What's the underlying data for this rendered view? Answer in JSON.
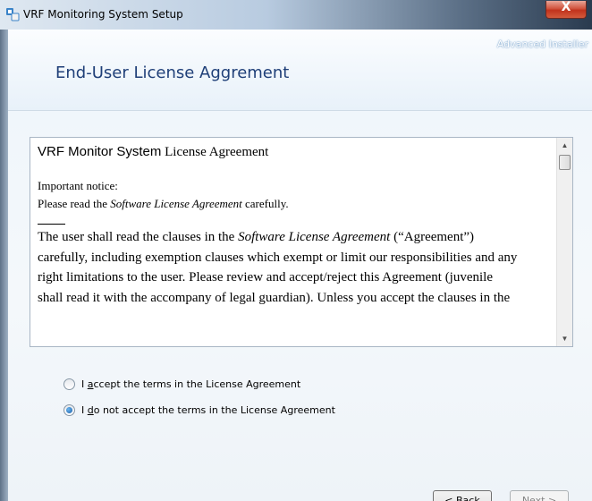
{
  "window": {
    "title": "VRF Monitoring System Setup",
    "close_label": "X",
    "brand": "Advanced Installer"
  },
  "header": {
    "title": "End-User License Aggrement"
  },
  "license": {
    "title_part1": "VRF Monitor System",
    "title_part2": " License Agreement",
    "important": "Important notice:",
    "please_prefix": "Please read the ",
    "please_italic": "Software License Agreement",
    "please_suffix": " carefully.",
    "para_line1_prefix": "The user shall read the clauses in the ",
    "para_line1_italic": "Software License Agreement",
    "para_line1_suffix": " (“Agreement”)",
    "para_line2": "carefully, including exemption clauses which exempt or limit our responsibilities and any",
    "para_line3": "right limitations to the user. Please review and accept/reject this Agreement (juvenile",
    "para_line4": "shall read it with the accompany of legal guardian). Unless you accept the clauses in the"
  },
  "options": {
    "accept_pre": "I ",
    "accept_u": "a",
    "accept_post": "ccept the terms in the License Agreement",
    "decline_pre": "I ",
    "decline_u": "d",
    "decline_post": "o not accept the terms in the License Agreement",
    "selected": "decline"
  },
  "buttons": {
    "back": "< Back",
    "next": "Next >"
  },
  "colors": {
    "title_blue": "#1f3f78",
    "close_red": "#c1331d"
  }
}
